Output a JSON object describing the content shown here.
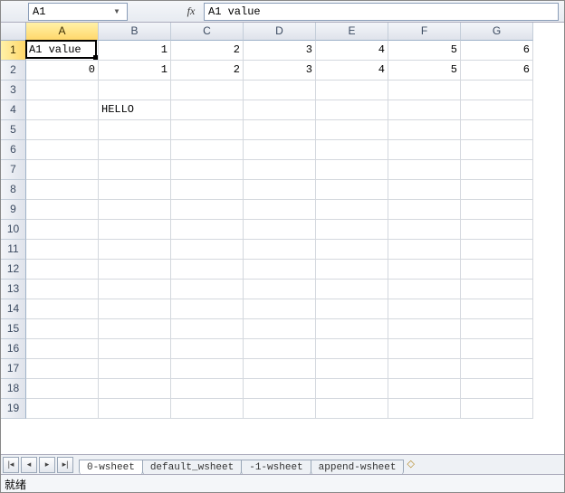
{
  "namebox": {
    "ref": "A1"
  },
  "formula_bar": {
    "fx_label": "fx",
    "value": "A1 value"
  },
  "columns": [
    "A",
    "B",
    "C",
    "D",
    "E",
    "F",
    "G"
  ],
  "rows": [
    "1",
    "2",
    "3",
    "4",
    "5",
    "6",
    "7",
    "8",
    "9",
    "10",
    "11",
    "12",
    "13",
    "14",
    "15",
    "16",
    "17",
    "18",
    "19"
  ],
  "selected": {
    "col_index": 0,
    "row_index": 0
  },
  "cells": {
    "A1": {
      "v": "A1 value",
      "t": "txt"
    },
    "B1": {
      "v": "1",
      "t": "num"
    },
    "C1": {
      "v": "2",
      "t": "num"
    },
    "D1": {
      "v": "3",
      "t": "num"
    },
    "E1": {
      "v": "4",
      "t": "num"
    },
    "F1": {
      "v": "5",
      "t": "num"
    },
    "G1": {
      "v": "6",
      "t": "num"
    },
    "A2": {
      "v": "0",
      "t": "num"
    },
    "B2": {
      "v": "1",
      "t": "num"
    },
    "C2": {
      "v": "2",
      "t": "num"
    },
    "D2": {
      "v": "3",
      "t": "num"
    },
    "E2": {
      "v": "4",
      "t": "num"
    },
    "F2": {
      "v": "5",
      "t": "num"
    },
    "G2": {
      "v": "6",
      "t": "num"
    },
    "B4": {
      "v": "HELLO",
      "t": "txt"
    }
  },
  "sheet_tabs": {
    "nav": {
      "first": "|◂",
      "prev": "◂",
      "next": "▸",
      "last": "▸|"
    },
    "items": [
      {
        "label": "0-wsheet",
        "active": true
      },
      {
        "label": "default_wsheet",
        "active": false
      },
      {
        "label": "-1-wsheet",
        "active": false
      },
      {
        "label": "append-wsheet",
        "active": false
      }
    ],
    "new_icon": "◇"
  },
  "status_bar": {
    "text": "就绪"
  }
}
